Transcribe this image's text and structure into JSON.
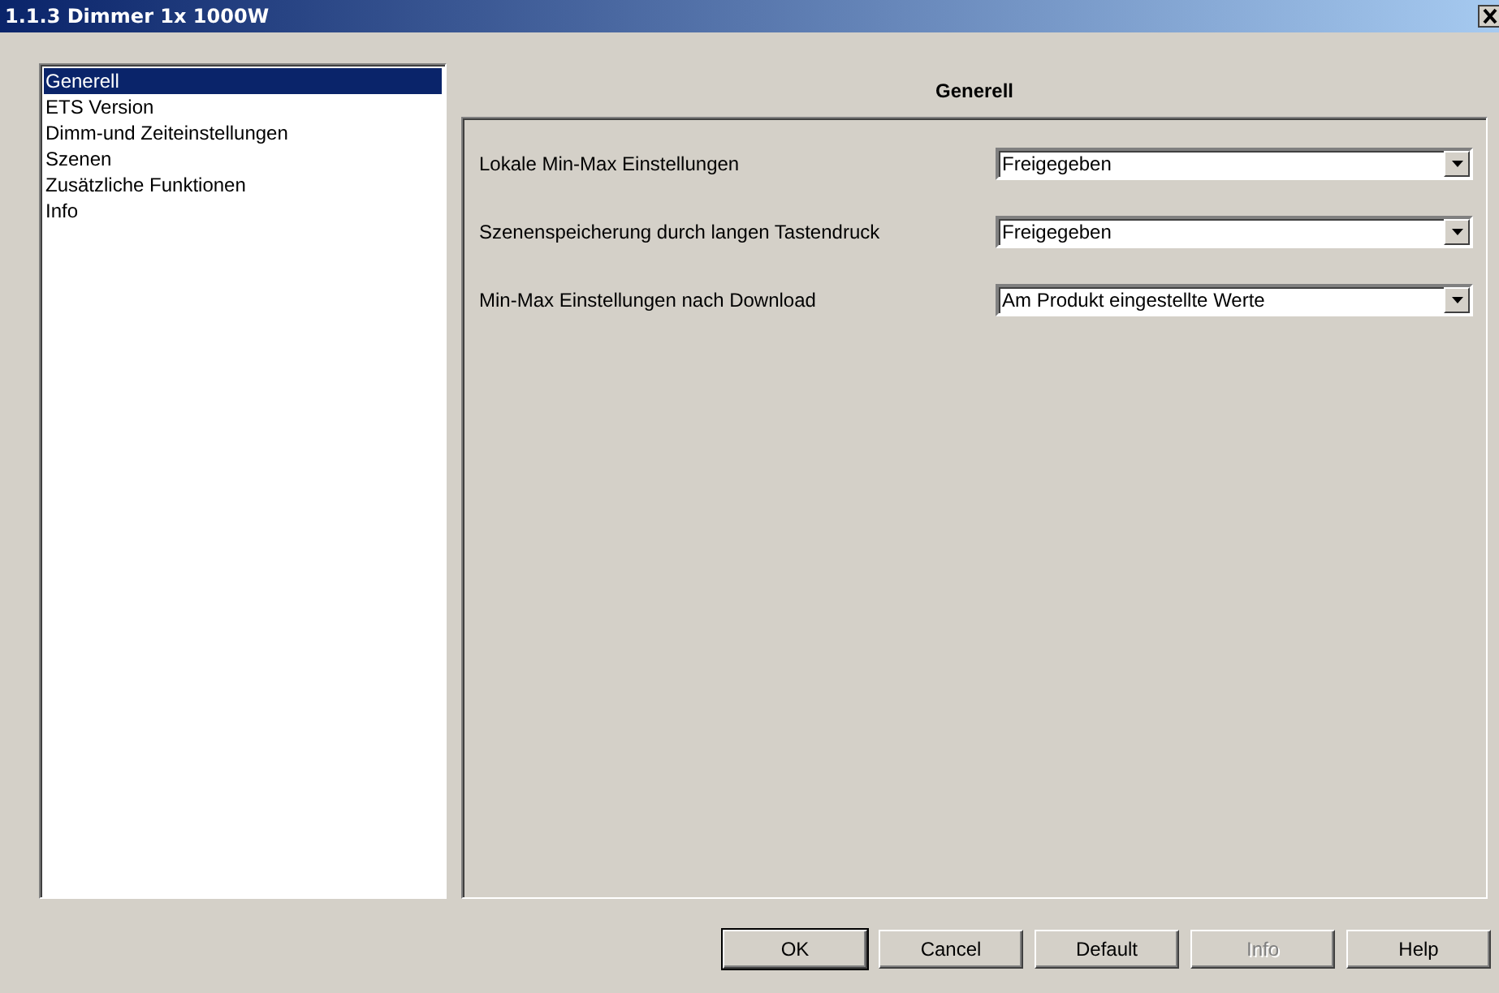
{
  "window": {
    "title": "1.1.3 Dimmer 1x 1000W"
  },
  "sidebar": {
    "items": [
      {
        "label": "Generell",
        "selected": true
      },
      {
        "label": "ETS Version",
        "selected": false
      },
      {
        "label": "Dimm-und Zeiteinstellungen",
        "selected": false
      },
      {
        "label": "Szenen",
        "selected": false
      },
      {
        "label": "Zusätzliche Funktionen",
        "selected": false
      },
      {
        "label": "Info",
        "selected": false
      }
    ]
  },
  "panel": {
    "title": "Generell",
    "settings": [
      {
        "label": "Lokale Min-Max Einstellungen",
        "value": "Freigegeben"
      },
      {
        "label": "Szenenspeicherung durch langen Tastendruck",
        "value": "Freigegeben"
      },
      {
        "label": "Min-Max Einstellungen nach Download",
        "value": "Am Produkt eingestellte Werte"
      }
    ]
  },
  "buttons": [
    {
      "label": "OK",
      "disabled": false,
      "default": true
    },
    {
      "label": "Cancel",
      "disabled": false,
      "default": false
    },
    {
      "label": "Default",
      "disabled": false,
      "default": false
    },
    {
      "label": "Info",
      "disabled": true,
      "default": false
    },
    {
      "label": "Help",
      "disabled": false,
      "default": false
    }
  ]
}
